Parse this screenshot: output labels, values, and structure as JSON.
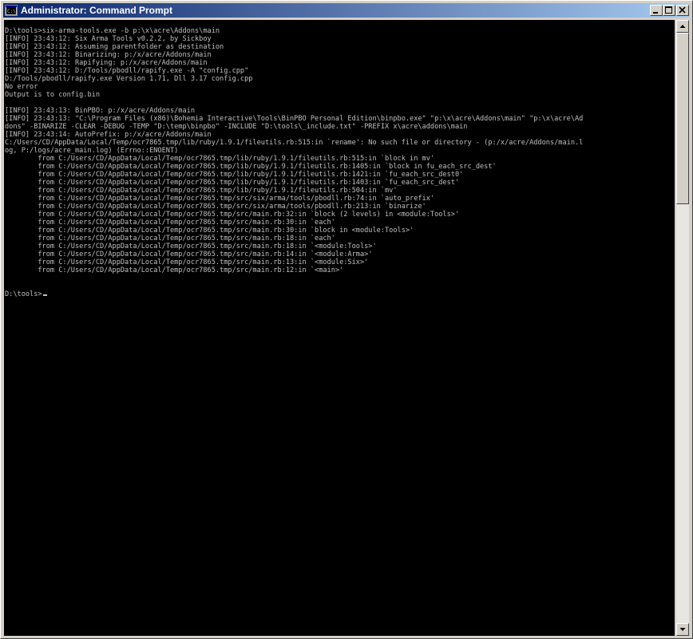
{
  "window": {
    "title": "Administrator: Command Prompt",
    "icon": "cmd-icon",
    "controls": {
      "minimize_icon": "minimize-icon",
      "maximize_icon": "maximize-icon",
      "close_icon": "close-icon"
    }
  },
  "colors": {
    "console_background": "#000000",
    "console_text": "#c0c0c0",
    "titlebar_start": "#0a246a",
    "titlebar_end": "#a6caf0"
  },
  "console": {
    "lines": [
      "D:\\tools>six-arma-tools.exe -b p:\\x\\acre\\Addons\\main",
      "[INFO] 23:43:12: Six Arma Tools v0.2.2, by Sickboy",
      "[INFO] 23:43:12: Assuming parentfolder as destination",
      "[INFO] 23:43:12: Binarizing: p:/x/acre/Addons/main",
      "[INFO] 23:43:12: Rapifying: p:/x/acre/Addons/main",
      "[INFO] 23:43:12: D:/Tools/pbodll/rapify.exe -A \"config.cpp\"",
      "D:/Tools/pbodll/rapify.exe Version 1.71, Dll 3.17 config.cpp",
      "No error",
      "Output is to config.bin",
      "",
      "[INFO] 23:43:13: BinPBO: p:/x/acre/Addons/main",
      "[INFO] 23:43:13: \"C:\\Program Files (x86)\\Bohemia Interactive\\Tools\\BinPBO Personal Edition\\binpbo.exe\" \"p:\\x\\acre\\Addons\\main\" \"p:\\x\\acre\\Ad",
      "dons\" -BINARIZE -CLEAR -DEBUG -TEMP \"D:\\temp\\binpbo\" -INCLUDE \"D:\\tools\\_include.txt\" -PREFIX x\\acre\\addons\\main",
      "[INFO] 23:43:14: AutoPrefix: p:/x/acre/Addons/main",
      "C:/Users/CD/AppData/Local/Temp/ocr7865.tmp/lib/ruby/1.9.1/fileutils.rb:515:in `rename': No such file or directory - (p:/x/acre/Addons/main.l",
      "og, P:/logs/acre_main.log) (Errno::ENOENT)",
      "        from C:/Users/CD/AppData/Local/Temp/ocr7865.tmp/lib/ruby/1.9.1/fileutils.rb:515:in `block in mv'",
      "        from C:/Users/CD/AppData/Local/Temp/ocr7865.tmp/lib/ruby/1.9.1/fileutils.rb:1405:in `block in fu_each_src_dest'",
      "        from C:/Users/CD/AppData/Local/Temp/ocr7865.tmp/lib/ruby/1.9.1/fileutils.rb:1421:in `fu_each_src_dest0'",
      "        from C:/Users/CD/AppData/Local/Temp/ocr7865.tmp/lib/ruby/1.9.1/fileutils.rb:1403:in `fu_each_src_dest'",
      "        from C:/Users/CD/AppData/Local/Temp/ocr7865.tmp/lib/ruby/1.9.1/fileutils.rb:504:in `mv'",
      "        from C:/Users/CD/AppData/Local/Temp/ocr7865.tmp/src/six/arma/tools/pbodll.rb:74:in `auto_prefix'",
      "        from C:/Users/CD/AppData/Local/Temp/ocr7865.tmp/src/six/arma/tools/pbodll.rb:213:in `binarize'",
      "        from C:/Users/CD/AppData/Local/Temp/ocr7865.tmp/src/main.rb:32:in `block (2 levels) in <module:Tools>'",
      "        from C:/Users/CD/AppData/Local/Temp/ocr7865.tmp/src/main.rb:30:in `each'",
      "        from C:/Users/CD/AppData/Local/Temp/ocr7865.tmp/src/main.rb:30:in `block in <module:Tools>'",
      "        from C:/Users/CD/AppData/Local/Temp/ocr7865.tmp/src/main.rb:18:in `each'",
      "        from C:/Users/CD/AppData/Local/Temp/ocr7865.tmp/src/main.rb:18:in `<module:Tools>'",
      "        from C:/Users/CD/AppData/Local/Temp/ocr7865.tmp/src/main.rb:14:in `<module:Arma>'",
      "        from C:/Users/CD/AppData/Local/Temp/ocr7865.tmp/src/main.rb:13:in `<module:Six>'",
      "        from C:/Users/CD/AppData/Local/Temp/ocr7865.tmp/src/main.rb:12:in `<main>'",
      "",
      "",
      "D:\\tools>"
    ],
    "cursor_line": 33
  },
  "scrollbar": {
    "up_icon": "scroll-up-arrow-icon",
    "down_icon": "scroll-down-arrow-icon",
    "thumb_fraction": 0.29
  }
}
